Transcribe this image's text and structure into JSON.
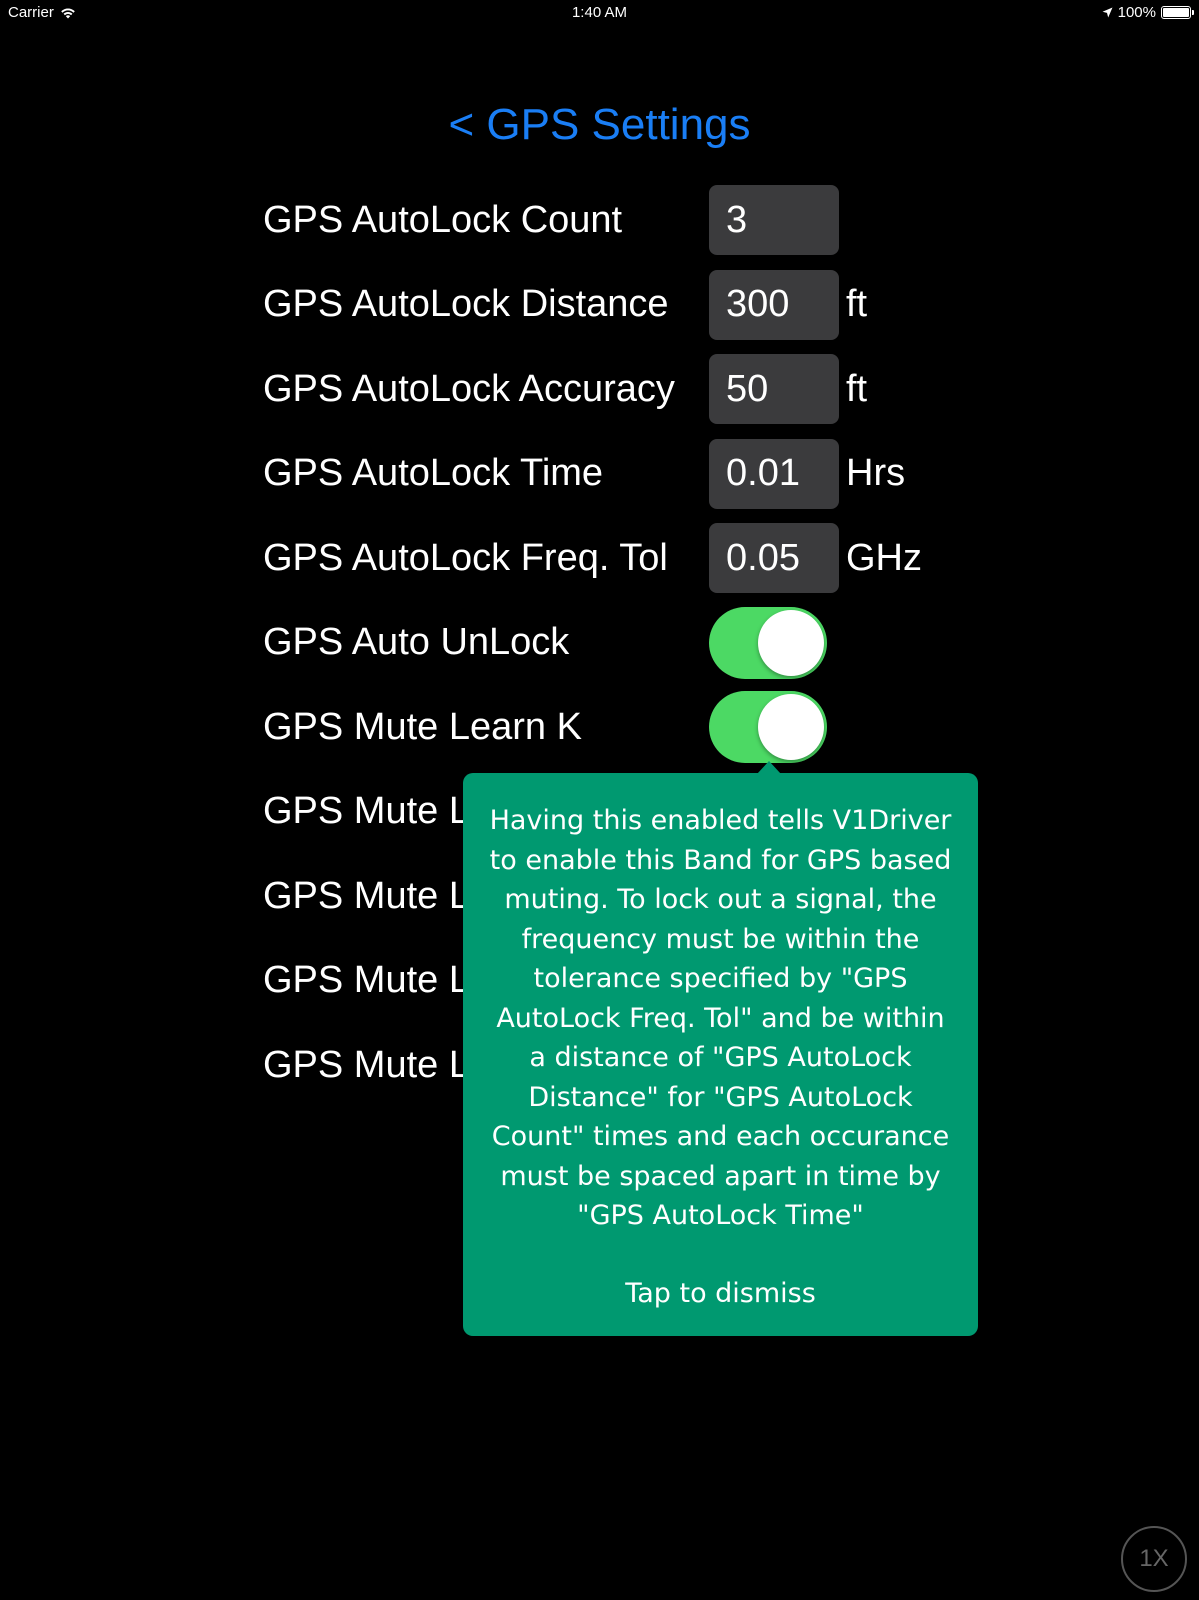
{
  "status_bar": {
    "carrier": "Carrier",
    "time": "1:40 AM",
    "battery": "100%",
    "battery_level": 1.0
  },
  "nav": {
    "back_title": "< GPS Settings",
    "accent_color": "#1a7ef5"
  },
  "settings": {
    "autolock_count": {
      "label": "GPS AutoLock Count",
      "value": "3",
      "unit": ""
    },
    "autolock_distance": {
      "label": "GPS AutoLock Distance",
      "value": "300",
      "unit": "ft"
    },
    "autolock_accuracy": {
      "label": "GPS AutoLock Accuracy",
      "value": "50",
      "unit": "ft"
    },
    "autolock_time": {
      "label": "GPS AutoLock Time",
      "value": "0.01",
      "unit": "Hrs"
    },
    "autolock_freq_tol": {
      "label": "GPS AutoLock Freq. Tol",
      "value": "0.05",
      "unit": "GHz"
    },
    "auto_unlock": {
      "label": "GPS Auto UnLock",
      "on": true
    },
    "mute_learn_k": {
      "label": "GPS Mute Learn K",
      "on": true
    },
    "mute_l_1": {
      "label": "GPS Mute L"
    },
    "mute_l_2": {
      "label": "GPS Mute L"
    },
    "mute_l_3": {
      "label": "GPS Mute L"
    },
    "mute_l_4": {
      "label": "GPS Mute L"
    },
    "toggle_on_color": "#4cd964"
  },
  "popover": {
    "message": "Having this enabled tells V1Driver to enable this Band for GPS based muting. To lock out a signal, the frequency must be within the tolerance specified by \"GPS AutoLock Freq. Tol\" and be within a distance of \"GPS AutoLock Distance\" for \"GPS AutoLock Count\" times and each occurance must be spaced apart in time by \"GPS AutoLock Time\"",
    "dismiss": "Tap to dismiss",
    "background_color": "#009970"
  },
  "zoom": {
    "label": "1X"
  }
}
